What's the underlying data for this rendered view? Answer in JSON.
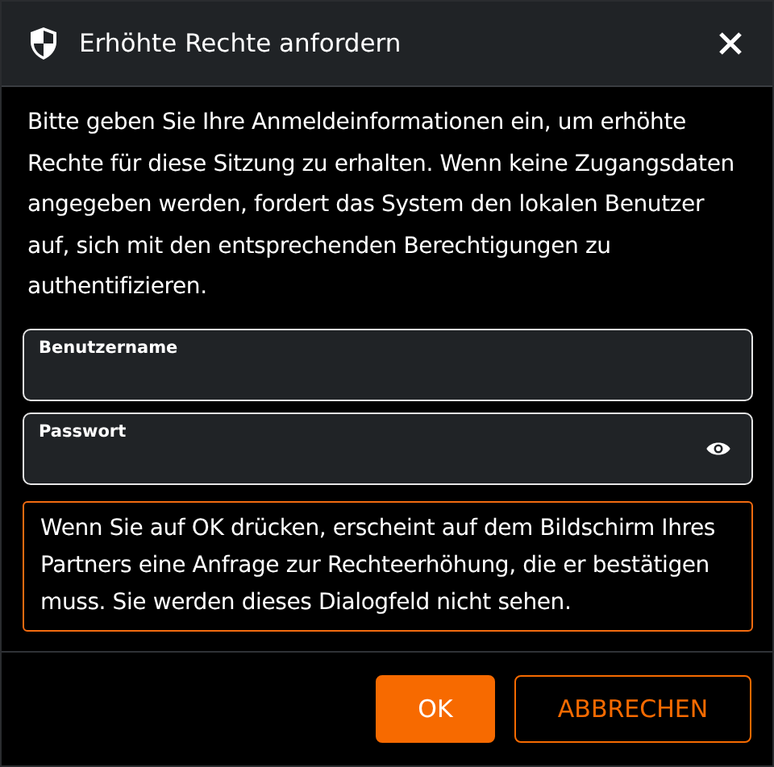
{
  "window": {
    "title": "Erhöhte Rechte anfordern"
  },
  "intro": "Bitte geben Sie Ihre Anmeldeinformationen ein, um erhöhte Rechte für diese Sitzung zu erhalten. Wenn keine Zugangsdaten angegeben werden, fordert das System den lokalen Benutzer auf, sich mit den entsprechenden Berechtigungen zu authentifizieren.",
  "fields": [
    {
      "label": "Benutzername",
      "kind": "text"
    },
    {
      "label": "Passwort",
      "kind": "password"
    }
  ],
  "notice": "Wenn Sie auf OK drücken, erscheint auf dem Bildschirm Ihres Partners eine Anfrage zur Rechteerhöhung, die er bestätigen muss. Sie werden dieses Dialogfeld nicht sehen.",
  "buttons": [
    {
      "label": "OK",
      "kind": "primary"
    },
    {
      "label": "ABBRECHEN",
      "kind": "secondary"
    }
  ]
}
